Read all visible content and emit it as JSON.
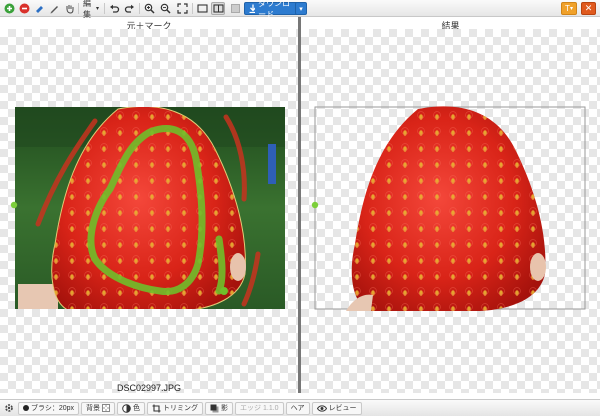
{
  "toolbar": {
    "edit_menu": "編集",
    "download_label": "ダウンロード",
    "toolbox_label": "T"
  },
  "panels": {
    "left_title": "元＋マーク",
    "right_title": "結果",
    "filename": "DSC02997.JPG"
  },
  "bottombar": {
    "brush": "ブラシ：20px",
    "background": "背景",
    "color": "色",
    "trimming": "トリミング",
    "shadow": "影",
    "edge": "エッジ 1.1.0",
    "hair": "ヘア",
    "review": "レビュー"
  },
  "colors": {
    "accent_blue": "#2d7bcf",
    "mark_green": "#6fbf2a",
    "mark_red": "#c8331f",
    "toolbox_orange": "#f0a12a"
  }
}
